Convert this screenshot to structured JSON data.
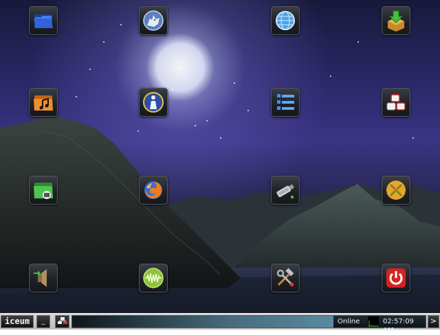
{
  "taskbar": {
    "start_label": "iceum",
    "show_desktop_label": "_",
    "status_text": "Online",
    "clock": "02:57:09 AM",
    "tray_arrow_label": ">"
  },
  "desktop_icons": [
    {
      "icon": "folder-icon"
    },
    {
      "icon": "wolf-icon"
    },
    {
      "icon": "globe-browser-icon"
    },
    {
      "icon": "download-box-icon"
    },
    {
      "icon": "music-folder-icon"
    },
    {
      "icon": "person-info-icon"
    },
    {
      "icon": "list-view-icon"
    },
    {
      "icon": "keyboard-keys-icon"
    },
    {
      "icon": "network-folder-icon"
    },
    {
      "icon": "firefox-icon"
    },
    {
      "icon": "usb-drive-icon"
    },
    {
      "icon": "tools-cross-icon"
    },
    {
      "icon": "speaker-volume-icon"
    },
    {
      "icon": "audio-wave-icon"
    },
    {
      "icon": "hammer-wrench-icon"
    },
    {
      "icon": "power-icon"
    }
  ],
  "colors": {
    "power": "#d42323",
    "folder": "#2f63d8",
    "usb_led": "#4bd34b"
  }
}
